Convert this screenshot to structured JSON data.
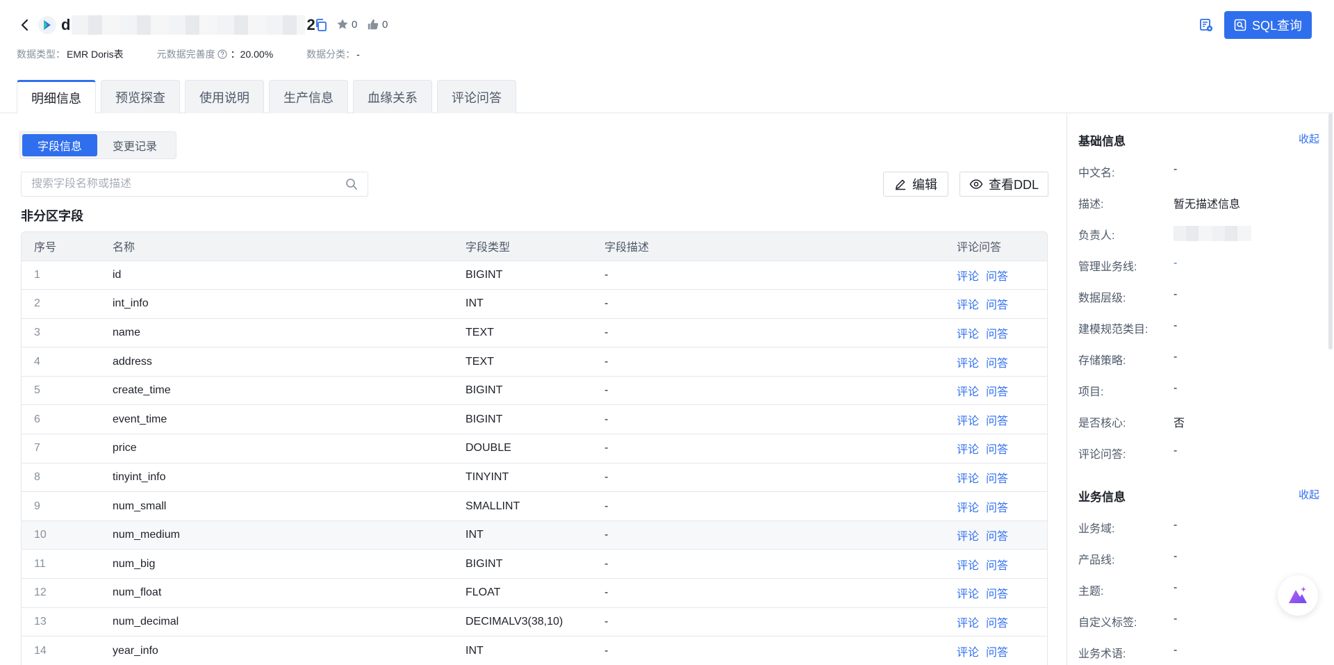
{
  "header": {
    "title_start": "d",
    "title_end": "2",
    "star_count": "0",
    "like_count": "0",
    "meta": [
      {
        "label": "数据类型：",
        "value": "EMR Doris表"
      },
      {
        "label": "元数据完善度",
        "value": "：20.00%"
      },
      {
        "label": "数据分类：",
        "value": "-"
      }
    ],
    "sql_button_label": "SQL查询"
  },
  "tabs": [
    {
      "label": "明细信息",
      "active": true
    },
    {
      "label": "预览探查"
    },
    {
      "label": "使用说明"
    },
    {
      "label": "生产信息"
    },
    {
      "label": "血缘关系"
    },
    {
      "label": "评论问答"
    }
  ],
  "main": {
    "segments": [
      "字段信息",
      "变更记录"
    ],
    "search_placeholder": "搜索字段名称或描述",
    "edit_label": "编辑",
    "ddl_label": "查看DDL",
    "section_title": "非分区字段",
    "columns": [
      "序号",
      "名称",
      "字段类型",
      "字段描述",
      "评论问答"
    ],
    "link_comment": "评论",
    "link_qa": "问答",
    "rows": [
      {
        "idx": "1",
        "name": "id",
        "type": "BIGINT",
        "desc": "-"
      },
      {
        "idx": "2",
        "name": "int_info",
        "type": "INT",
        "desc": "-"
      },
      {
        "idx": "3",
        "name": "name",
        "type": "TEXT",
        "desc": "-"
      },
      {
        "idx": "4",
        "name": "address",
        "type": "TEXT",
        "desc": "-"
      },
      {
        "idx": "5",
        "name": "create_time",
        "type": "BIGINT",
        "desc": "-"
      },
      {
        "idx": "6",
        "name": "event_time",
        "type": "BIGINT",
        "desc": "-"
      },
      {
        "idx": "7",
        "name": "price",
        "type": "DOUBLE",
        "desc": "-"
      },
      {
        "idx": "8",
        "name": "tinyint_info",
        "type": "TINYINT",
        "desc": "-"
      },
      {
        "idx": "9",
        "name": "num_small",
        "type": "SMALLINT",
        "desc": "-"
      },
      {
        "idx": "10",
        "name": "num_medium",
        "type": "INT",
        "desc": "-"
      },
      {
        "idx": "11",
        "name": "num_big",
        "type": "BIGINT",
        "desc": "-"
      },
      {
        "idx": "12",
        "name": "num_float",
        "type": "FLOAT",
        "desc": "-"
      },
      {
        "idx": "13",
        "name": "num_decimal",
        "type": "DECIMALV3(38,10)",
        "desc": "-"
      },
      {
        "idx": "14",
        "name": "year_info",
        "type": "INT",
        "desc": "-"
      }
    ]
  },
  "side": {
    "basic_title": "基础信息",
    "collapse_label": "收起",
    "basic": [
      {
        "label": "中文名:",
        "value": "-"
      },
      {
        "label": "描述:",
        "value": "暂无描述信息"
      },
      {
        "label": "负责人:",
        "value": ""
      },
      {
        "label": "管理业务线:",
        "value": "-"
      },
      {
        "label": "数据层级:",
        "value": "-"
      },
      {
        "label": "建模规范类目:",
        "value": "-"
      },
      {
        "label": "存储策略:",
        "value": "-"
      },
      {
        "label": "项目:",
        "value": "-"
      },
      {
        "label": "是否核心:",
        "value": "否"
      },
      {
        "label": "评论问答:",
        "value": "-"
      }
    ],
    "business_title": "业务信息",
    "business": [
      {
        "label": "业务域:",
        "value": "-"
      },
      {
        "label": "产品线:",
        "value": "-"
      },
      {
        "label": "主题:",
        "value": "-"
      },
      {
        "label": "自定义标签:",
        "value": "-"
      },
      {
        "label": "业务术语:",
        "value": "-"
      }
    ]
  },
  "colors": {
    "accent": "#2f6fed",
    "text": "#1d2129",
    "muted": "#86909c",
    "border": "#e5e6eb"
  }
}
